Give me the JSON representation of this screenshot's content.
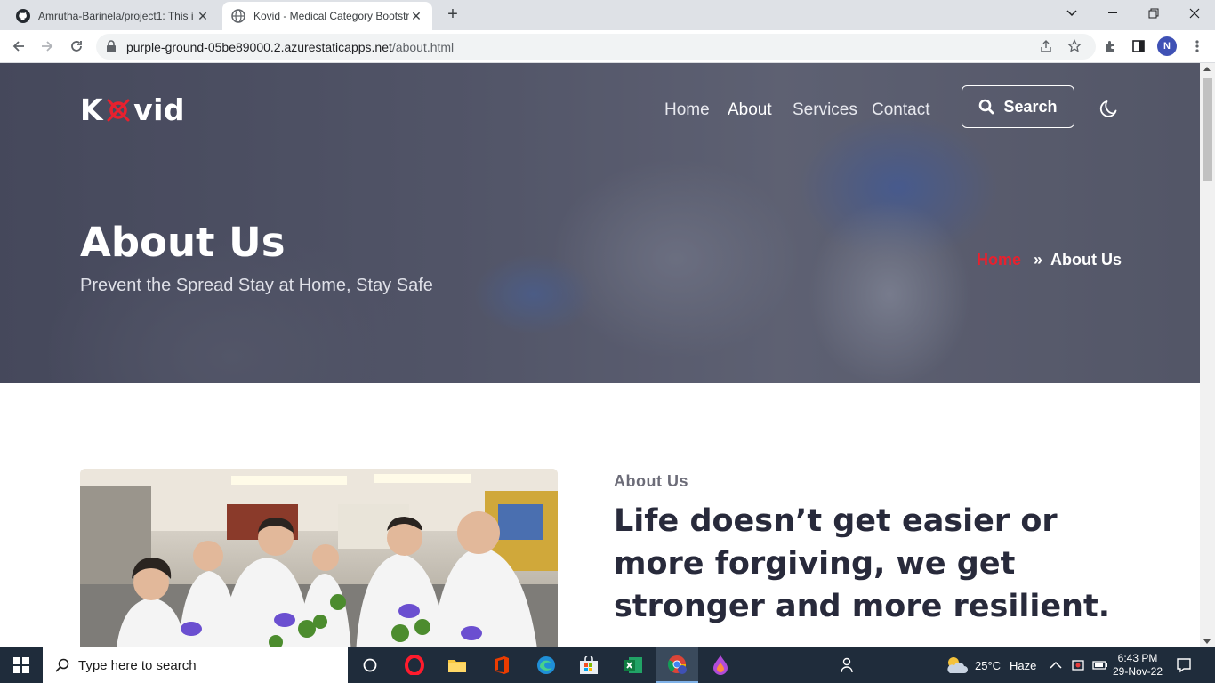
{
  "browser": {
    "tabs": [
      {
        "title": "Amrutha-Barinela/project1: This i",
        "active": false
      },
      {
        "title": "Kovid - Medical Category Bootstr",
        "active": true
      }
    ],
    "url_host": "purple-ground-05be89000.2.azurestaticapps.net",
    "url_path": "/about.html",
    "profile_initial": "N"
  },
  "site": {
    "logo_left": "K",
    "logo_right": "vid",
    "nav": [
      "Home",
      "About",
      "Services",
      "Contact"
    ],
    "search_label": "Search"
  },
  "hero": {
    "title": "About Us",
    "subtitle": "Prevent the Spread Stay at Home, Stay Safe",
    "breadcrumb_home": "Home",
    "breadcrumb_sep": "»",
    "breadcrumb_current": "About Us"
  },
  "about": {
    "eyebrow": "About Us",
    "heading": "Life doesn’t get easier or more forgiving, we get stronger and more resilient."
  },
  "taskbar": {
    "search_placeholder": "Type here to search",
    "weather_temp": "25°C",
    "weather_desc": "Haze",
    "time": "6:43 PM",
    "date": "29-Nov-22"
  },
  "colors": {
    "accent_red": "#e8212e",
    "heading_dark": "#282a3b",
    "taskbar_bg": "#1f2c3b"
  }
}
